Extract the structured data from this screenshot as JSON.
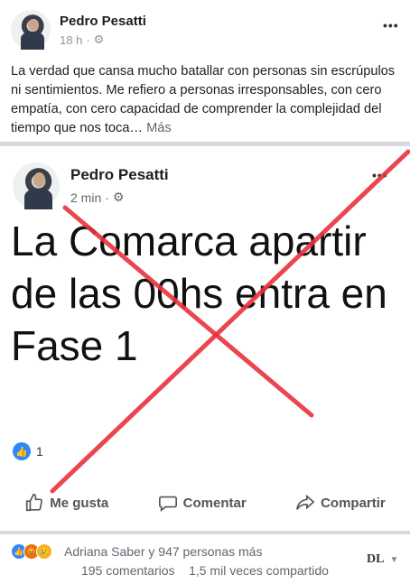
{
  "post": {
    "author": "Pedro Pesatti",
    "time": "18 h",
    "text": "La verdad que cansa mucho batallar con personas sin escrúpulos ni sentimientos. Me refiero a personas irresponsables, con cero empatía, con cero capacidad de comprender la complejidad del tiempo que nos toca…",
    "more": "Más",
    "menu": "•••"
  },
  "shared": {
    "author": "Pedro Pesatti",
    "time": "2 min",
    "menu": "•••",
    "headline": "La Comarca apartir de las 00hs entra en Fase 1",
    "like_count": "1",
    "actions": {
      "like": "Me gusta",
      "comment": "Comentar",
      "share": "Compartir"
    }
  },
  "footer": {
    "reactors": "Adriana Saber y 947 personas más",
    "comments": "195 comentarios",
    "shares": "1,5 mil veces compartido",
    "page_label": "DL"
  },
  "colors": {
    "cross": "#e8323c",
    "like_blue": "#2d88ff",
    "divider": "#d8dadf"
  }
}
